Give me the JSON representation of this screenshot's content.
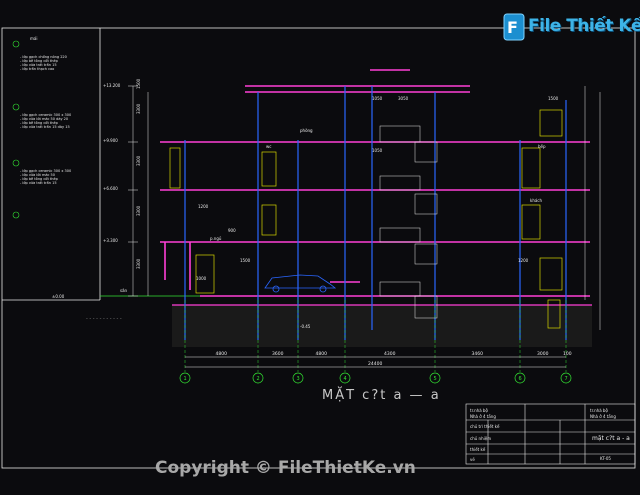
{
  "logo": {
    "text": "File Thiết Kế.vn",
    "icon": "file-logo-icon"
  },
  "drawing": {
    "title": "MẶT c?t a — a",
    "top_label": "mái",
    "left_notes": [
      "- lớp gạch chống nóng 220",
      "- lớp bê tông cốt thép",
      "- lớp vữa trát trần 15",
      "- lớp trần thạch cao",
      "- lớp gạch ceramic 300 x 300",
      "- lớp vữa lót mác 50 dày 20",
      "- lớp bê tông cốt thép",
      "- lớp vữa trát trần 15 dày 15",
      "- lớp gạch ceramic 300 x 300",
      "- lớp vữa lót mác 50",
      "- lớp bê tông cốt thép",
      "- lớp vữa trát trần 15"
    ],
    "bottom_dims": [
      "4800",
      "3600",
      "4800",
      "4300",
      "3460",
      "3000",
      "100"
    ],
    "overall_dim": "24400",
    "axis_labels": [
      "1",
      "2",
      "3",
      "4",
      "5",
      "6",
      "7"
    ],
    "level_dims": [
      "3300",
      "3300",
      "3300",
      "3300",
      "1500"
    ],
    "inner_dims": [
      "1050",
      "3050",
      "1500",
      "1200",
      "1500",
      "1050",
      "1200",
      "1000",
      "900"
    ],
    "room_labels": [
      "phòng",
      "wc",
      "bếp",
      "khách",
      "p.ngủ",
      "sân"
    ],
    "misc_labels": [
      "cao độ ±0.00",
      "±0.00",
      "-0.45",
      "+3.300",
      "+6.600",
      "+9.900",
      "+13.200"
    ]
  },
  "title_block": {
    "header": "tr.nhà bộ",
    "sub": "Nhà ở 4 tầng",
    "rows": [
      "chủ trì thiết kế",
      "chủ nhiệm",
      "thiết kế",
      "vẽ"
    ],
    "sheet_title": "mặt c?t a - a",
    "sheet_no": "KT-05"
  },
  "footer": {
    "copyright": "Copyright © FileThietKe.vn"
  },
  "colors": {
    "background": "#0b0b0e",
    "floor": "#ff3fd6",
    "wall": "#2a66ff",
    "dim": "#d8d800",
    "green": "#33e333",
    "white": "#e8e8e8",
    "cyan": "#28d4ff"
  }
}
